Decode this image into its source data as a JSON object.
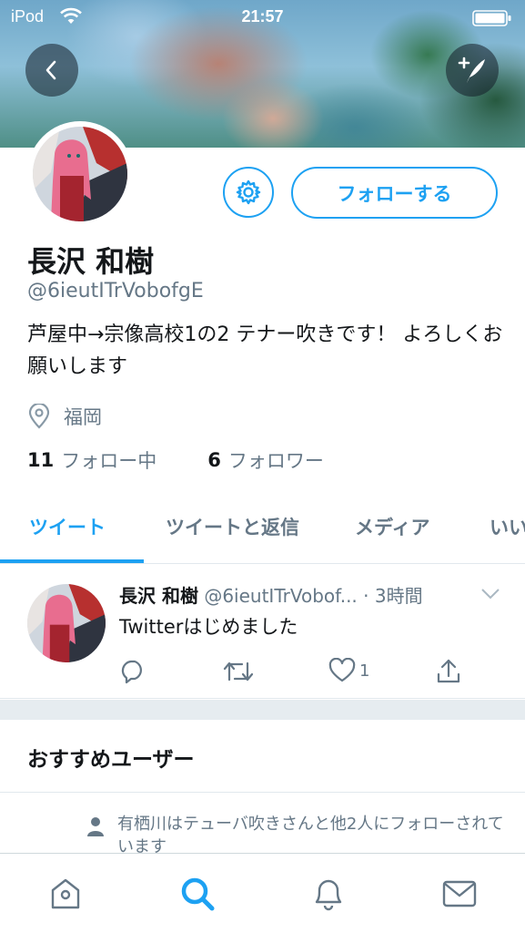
{
  "status_bar": {
    "device": "iPod",
    "time": "21:57"
  },
  "header": {
    "back_icon": "chevron-left-icon",
    "compose_icon": "compose-tweet-icon"
  },
  "profile": {
    "follow_label": "フォローする",
    "name": "長沢 和樹",
    "handle": "@6ieutITrVobofgE",
    "bio": "芦屋中→宗像高校1の2 テナー吹きです！ よろしくお願いします",
    "location": "福岡",
    "following_count": "11",
    "following_label": "フォロー中",
    "followers_count": "6",
    "followers_label": "フォロワー"
  },
  "tabs": [
    {
      "label": "ツイート",
      "active": true
    },
    {
      "label": "ツイートと返信",
      "active": false
    },
    {
      "label": "メディア",
      "active": false
    },
    {
      "label": "いい",
      "active": false
    }
  ],
  "tweet": {
    "name": "長沢 和樹",
    "handle": "@6ieutITrVobof...",
    "time": "· 3時間",
    "text": "Twitterはじめました",
    "like_count": "1"
  },
  "recommendations": {
    "title": "おすすめユーザー",
    "social_context": "有栖川はテューバ吹きさんと他2人にフォローされています"
  },
  "colors": {
    "accent": "#1da1f2",
    "secondary_text": "#657786",
    "divider": "#e6ecf0"
  }
}
